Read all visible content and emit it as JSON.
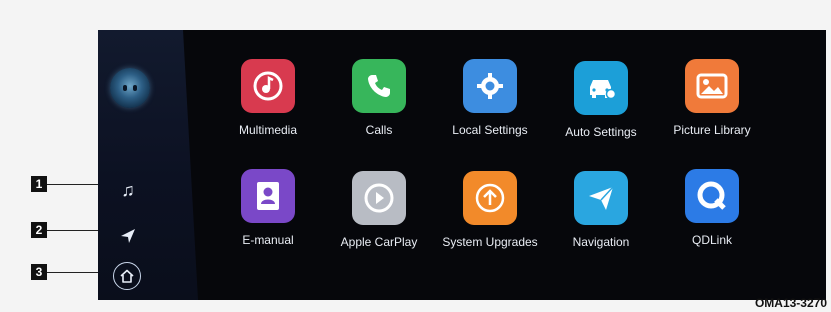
{
  "sidebar": {
    "voice_assistant_icon": "voice-assistant-icon",
    "items": [
      {
        "icon": "music-note-icon"
      },
      {
        "icon": "navigation-arrow-icon"
      },
      {
        "icon": "home-icon"
      }
    ]
  },
  "apps": [
    {
      "label": "Multimedia",
      "icon": "music-disc-icon",
      "color": "#d83a4f"
    },
    {
      "label": "Calls",
      "icon": "phone-icon",
      "color": "#37b65b"
    },
    {
      "label": "Local Settings",
      "icon": "gear-icon",
      "color": "#3d8de0"
    },
    {
      "label": "Auto Settings",
      "icon": "car-settings-icon",
      "color": "#1c9fd8"
    },
    {
      "label": "Picture Library",
      "icon": "picture-icon",
      "color": "#f07a3a"
    },
    {
      "label": "E-manual",
      "icon": "manual-person-icon",
      "color": "#7a48c8"
    },
    {
      "label": "Apple CarPlay",
      "icon": "carplay-icon",
      "color": "#b8bcc4"
    },
    {
      "label": "System Upgrades",
      "icon": "upgrade-icon",
      "color": "#f28a2a"
    },
    {
      "label": "Navigation",
      "icon": "paper-plane-icon",
      "color": "#2aa6e0"
    },
    {
      "label": "QDLink",
      "icon": "qdlink-icon",
      "color": "#2c7be6"
    }
  ],
  "callouts": [
    "1",
    "2",
    "3"
  ],
  "figure_code": "OMA13-3270"
}
